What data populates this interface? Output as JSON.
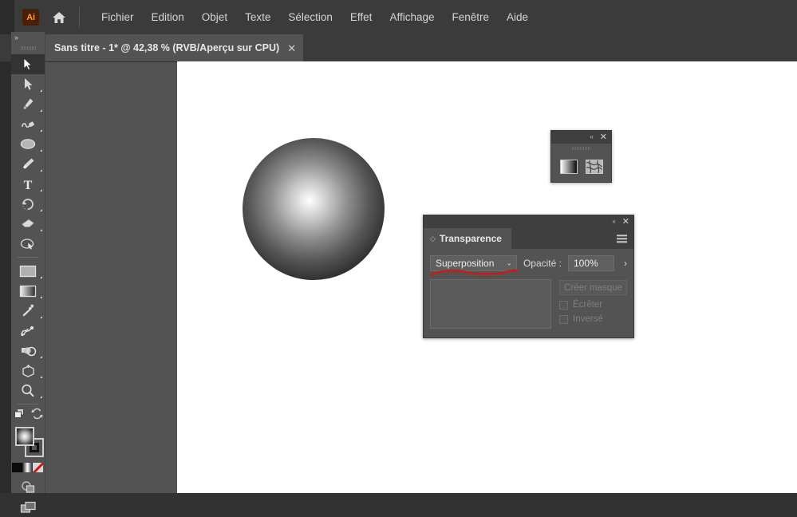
{
  "app": {
    "name": "Adobe Illustrator",
    "logo_text": "Ai",
    "logo_color": "#ff9a3c",
    "home_icon": "home-icon"
  },
  "menubar": {
    "items": [
      {
        "label": "Fichier"
      },
      {
        "label": "Edition"
      },
      {
        "label": "Objet"
      },
      {
        "label": "Texte"
      },
      {
        "label": "Sélection"
      },
      {
        "label": "Effet"
      },
      {
        "label": "Affichage"
      },
      {
        "label": "Fenêtre"
      },
      {
        "label": "Aide"
      }
    ]
  },
  "document_tab": {
    "title": "Sans titre - 1* @ 42,38 % (RVB/Aperçu sur CPU)",
    "close_label": "✕",
    "zoom_level": "42,38 %",
    "color_mode": "RVB",
    "preview_mode": "Aperçu sur CPU",
    "modified": true
  },
  "toolbar": {
    "expand_chevron": "»",
    "tools": [
      {
        "name": "selection-tool",
        "active": true,
        "has_flyout": false
      },
      {
        "name": "direct-selection-tool",
        "active": false,
        "has_flyout": true
      },
      {
        "name": "pen-tool",
        "active": false,
        "has_flyout": true
      },
      {
        "name": "curvature-tool",
        "active": false,
        "has_flyout": true
      },
      {
        "name": "ellipse-tool",
        "active": false,
        "has_flyout": true
      },
      {
        "name": "paintbrush-tool",
        "active": false,
        "has_flyout": true
      },
      {
        "name": "type-tool",
        "active": false,
        "has_flyout": true
      },
      {
        "name": "rotate-tool",
        "active": false,
        "has_flyout": true
      },
      {
        "name": "eraser-tool",
        "active": false,
        "has_flyout": true
      },
      {
        "name": "free-transform-tool",
        "active": false,
        "has_flyout": false
      },
      {
        "name": "rectangle-tool",
        "active": false,
        "has_flyout": true
      },
      {
        "name": "gradient-tool",
        "active": false,
        "has_flyout": true
      },
      {
        "name": "eyedropper-tool",
        "active": false,
        "has_flyout": true
      },
      {
        "name": "blend-tool",
        "active": false,
        "has_flyout": false
      },
      {
        "name": "shape-builder-tool",
        "active": false,
        "has_flyout": true
      },
      {
        "name": "perspective-grid-tool",
        "active": false,
        "has_flyout": true
      },
      {
        "name": "zoom-tool",
        "active": false,
        "has_flyout": true
      }
    ],
    "arrange_icons": [
      "stack-icon",
      "swap-arrows-icon"
    ],
    "fill_swatch": {
      "name": "fill-swatch",
      "type": "radial-gradient"
    },
    "stroke_swatch": {
      "name": "stroke-swatch",
      "type": "solid-black"
    },
    "color_strip": [
      "color-black",
      "gradient",
      "none"
    ],
    "bottom_icons": [
      "drawing-mode-icon",
      "screen-mode-icon"
    ]
  },
  "canvas": {
    "background": "#ffffff",
    "objects": [
      {
        "name": "sphere-object",
        "shape": "circle",
        "fill": "radial-gradient",
        "gradient_center": "#ffffff",
        "gradient_edge": "#000000"
      }
    ]
  },
  "mini_panel": {
    "collapse_label": "«",
    "close_label": "✕",
    "icons": [
      {
        "name": "gradient-swatch-icon"
      },
      {
        "name": "pattern-swatch-icon"
      }
    ]
  },
  "transparency_panel": {
    "collapse_label": "«",
    "close_label": "✕",
    "tab_label": "Transparence",
    "menu_icon": "panel-menu-icon",
    "blend_mode": {
      "value": "Superposition",
      "caret": "⌄",
      "annotated": true,
      "annotation_color": "#cc1a1a"
    },
    "opacity": {
      "label": "Opacité :",
      "value": "100%",
      "stepper": "›"
    },
    "mask_button": {
      "label": "Créer masque",
      "enabled": false
    },
    "checkboxes": [
      {
        "label": "Écrêter",
        "checked": false,
        "enabled": false
      },
      {
        "label": "Inversé",
        "checked": false,
        "enabled": false
      }
    ]
  }
}
